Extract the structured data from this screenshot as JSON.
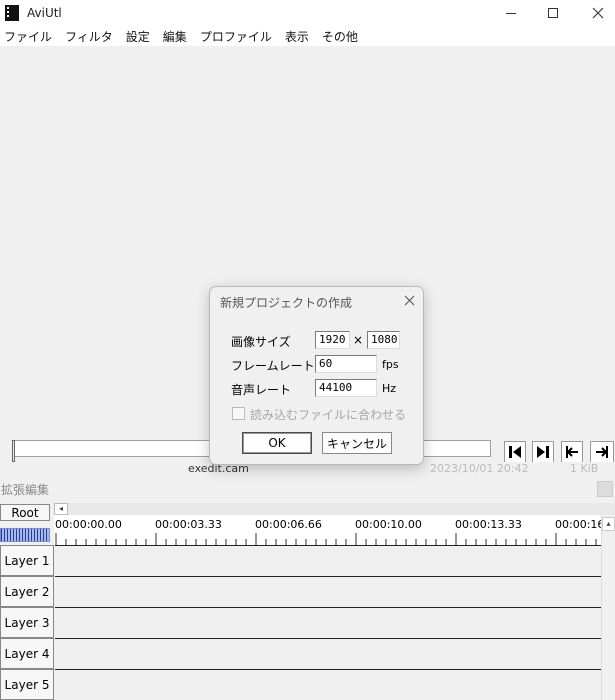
{
  "window": {
    "title": "AviUtl"
  },
  "menu": [
    "ファイル",
    "フィルタ",
    "設定",
    "編集",
    "プロファイル",
    "表示",
    "その他"
  ],
  "background_file": {
    "name": "exedit.cam",
    "date": "2023/10/01 20:42",
    "size": "1 KiB"
  },
  "extended_edit": {
    "title": "拡張編集",
    "root_label": "Root",
    "ruler": [
      "00:00:00.00",
      "00:00:03.33",
      "00:00:06.66",
      "00:00:10.00",
      "00:00:13.33",
      "00:00:16"
    ],
    "layers": [
      "Layer 1",
      "Layer 2",
      "Layer 3",
      "Layer 4",
      "Layer 5"
    ]
  },
  "dialog": {
    "title": "新規プロジェクトの作成",
    "image_size_label": "画像サイズ",
    "width": "1920",
    "times": "×",
    "height": "1080",
    "frame_rate_label": "フレームレート",
    "frame_rate": "60",
    "fps_unit": "fps",
    "audio_rate_label": "音声レート",
    "audio_rate": "44100",
    "hz_unit": "Hz",
    "match_file_label": "読み込むファイルに合わせる",
    "match_file_checked": false,
    "ok_label": "OK",
    "cancel_label": "キャンセル"
  },
  "icons": {
    "app": "film-strip-icon",
    "minimize": "minimize-icon",
    "maximize": "maximize-icon",
    "close": "close-icon",
    "play_back": "step-back-icon",
    "play_fwd": "step-forward-icon",
    "go_start": "go-start-icon",
    "go_end": "go-end-icon"
  }
}
